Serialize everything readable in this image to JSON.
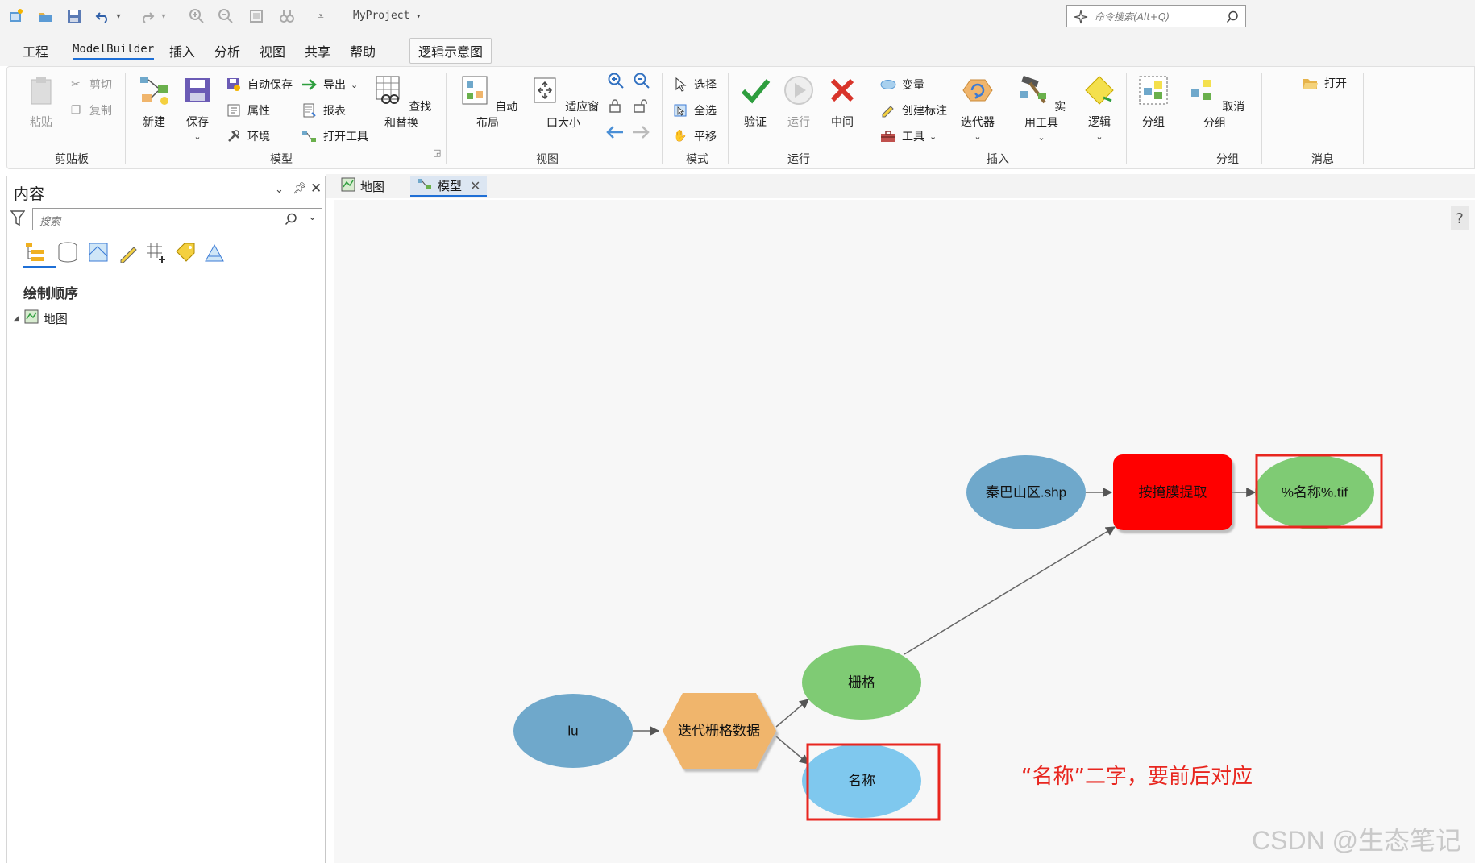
{
  "titlebar": {
    "project": "MyProject",
    "search_placeholder": "命令搜索(Alt+Q)"
  },
  "menu": {
    "tabs": [
      "工程",
      "ModelBuilder",
      "插入",
      "分析",
      "视图",
      "共享",
      "帮助"
    ],
    "context_tab": "逻辑示意图"
  },
  "ribbon": {
    "clipboard": {
      "label": "剪贴板",
      "paste": "粘贴",
      "cut": "剪切",
      "copy": "复制"
    },
    "model": {
      "label": "模型",
      "new": "新建",
      "save": "保存",
      "autosave": "自动保存",
      "properties": "属性",
      "environment": "环境",
      "export": "导出",
      "report": "报表",
      "open_tool": "打开工具",
      "find_replace": "查找和替换"
    },
    "view": {
      "label": "视图",
      "auto_layout": "自动布局",
      "fit_window": "适应窗口大小"
    },
    "mode": {
      "label": "模式",
      "select": "选择",
      "select_all": "全选",
      "pan": "平移"
    },
    "run": {
      "label": "运行",
      "validate": "验证",
      "run": "运行",
      "intermediate": "中间"
    },
    "insert": {
      "label": "插入",
      "variable": "变量",
      "create_label": "创建标注",
      "tools": "工具",
      "iterators": "迭代器",
      "utilities": "实用工具",
      "logic": "逻辑"
    },
    "group": {
      "label": "分组",
      "group": "分组",
      "ungroup": "取消分组"
    },
    "messages": {
      "label": "消息",
      "open": "打开"
    }
  },
  "contents": {
    "title": "内容",
    "search_placeholder": "搜索",
    "draw_order": "绘制顺序",
    "map_item": "地图"
  },
  "doc_tabs": [
    "地图",
    "模型"
  ],
  "canvas": {
    "help": "?"
  },
  "model": {
    "nodes": {
      "lu": "lu",
      "iterate": "迭代栅格数据",
      "raster": "栅格",
      "name": "名称",
      "mask": "秦巴山区.shp",
      "extract": "按掩膜提取",
      "output": "%名称%.tif"
    },
    "colors": {
      "input": "#6fa8cb",
      "tool_iter": "#f0b56c",
      "derived": "#7fcb74",
      "name_var": "#7fc8ee",
      "tool_error": "#ff0000",
      "highlight": "#e8261f"
    }
  },
  "annotation": "“名称”二字，要前后对应",
  "watermark": "CSDN @生态笔记"
}
